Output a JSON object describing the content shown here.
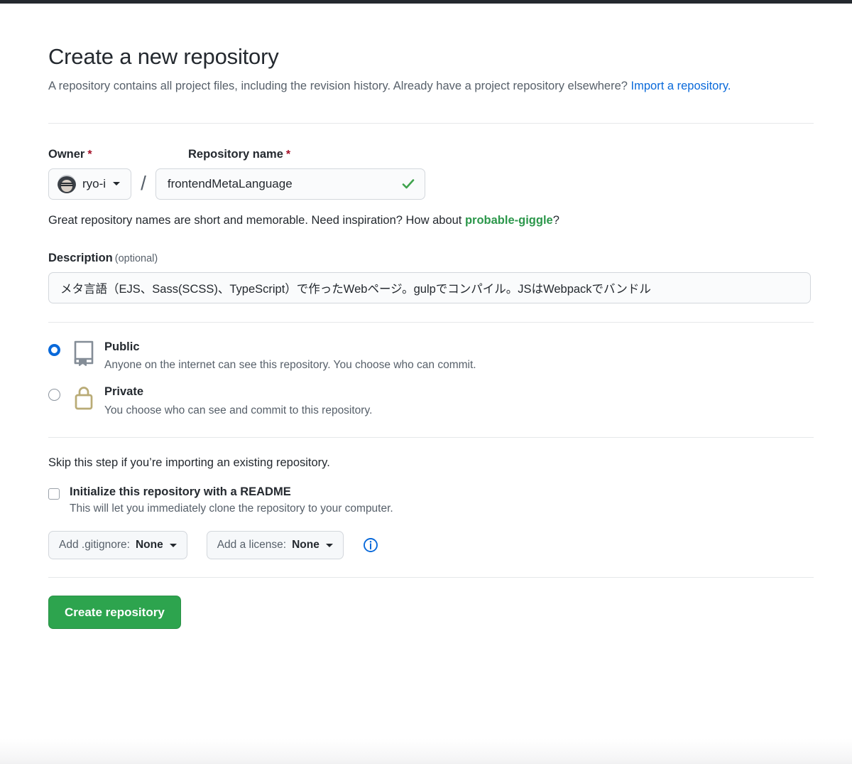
{
  "header": {
    "title": "Create a new repository",
    "intro_part1": "A repository contains all project files, including the revision history. Already have a project repository elsewhere? ",
    "import_link": "Import a repository."
  },
  "owner_field": {
    "label": "Owner",
    "required_mark": "*",
    "owner_name": "ryo-i",
    "avatar_alt": "ryo-i avatar",
    "separator": "/"
  },
  "repo_name_field": {
    "label": "Repository name",
    "required_mark": "*",
    "value": "frontendMetaLanguage",
    "placeholder": "",
    "valid": true,
    "valid_icon": "check-icon"
  },
  "name_hint": {
    "before": "Great repository names are short and memorable. Need inspiration? How about ",
    "suggestion": "probable-giggle",
    "after": "?"
  },
  "description_field": {
    "label": "Description",
    "optional_label": "(optional)",
    "value": "メタ言語（EJS、Sass(SCSS)、TypeScript）で作ったWebページ。gulpでコンパイル。JSはWebpackでバンドル",
    "placeholder": ""
  },
  "visibility": {
    "options": [
      {
        "id": "public",
        "title": "Public",
        "description": "Anyone on the internet can see this repository. You choose who can commit.",
        "icon": "repo-book-icon",
        "selected": true
      },
      {
        "id": "private",
        "title": "Private",
        "description": "You choose who can see and commit to this repository.",
        "icon": "lock-icon",
        "selected": false
      }
    ]
  },
  "initialize": {
    "skip_note": "Skip this step if you’re importing an existing repository.",
    "readme_label": "Initialize this repository with a README",
    "readme_description": "This will let you immediately clone the repository to your computer.",
    "readme_checked": false,
    "gitignore_prefix": "Add .gitignore: ",
    "gitignore_value": "None",
    "license_prefix": "Add a license: ",
    "license_value": "None",
    "info_icon": "info-icon"
  },
  "submit": {
    "label": "Create repository"
  },
  "colors": {
    "accent_blue": "#0969da",
    "green_button": "#2da44e",
    "green_text": "#2c974b",
    "required_red": "#a40e26",
    "lock_tan": "#b9ab76",
    "repo_gray": "#848d97",
    "divider": "#e6e8ea",
    "muted_text": "#57606a"
  }
}
